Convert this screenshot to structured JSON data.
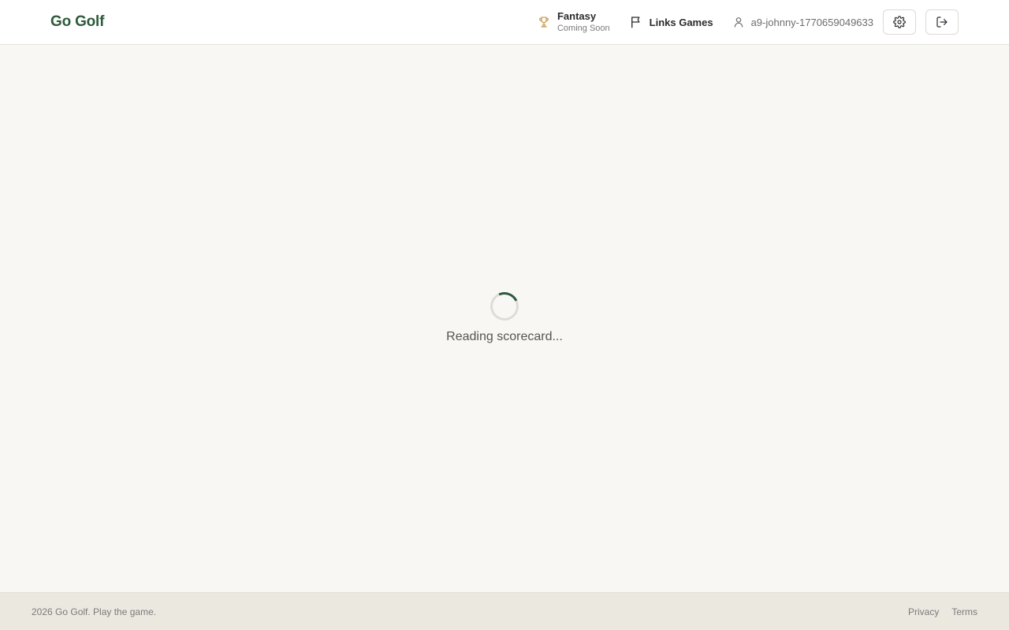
{
  "header": {
    "logo": "Go Golf",
    "fantasy": {
      "title": "Fantasy",
      "subtitle": "Coming Soon",
      "icon": "trophy-icon"
    },
    "links_games": {
      "label": "Links Games",
      "icon": "flag-icon"
    },
    "user": {
      "username": "a9-johnny-1770659049633",
      "icon": "user-icon"
    },
    "settings_icon": "gear-icon",
    "logout_icon": "logout-icon"
  },
  "main": {
    "loading_text": "Reading scorecard..."
  },
  "footer": {
    "copyright": "2026 Go Golf. Play the game.",
    "links": [
      {
        "label": "Privacy"
      },
      {
        "label": "Terms"
      }
    ]
  },
  "colors": {
    "brand": "#2d5a3b",
    "accent_trophy": "#c9a15a",
    "background": "#f8f7f3",
    "footer_bg": "#ebe8e0"
  }
}
